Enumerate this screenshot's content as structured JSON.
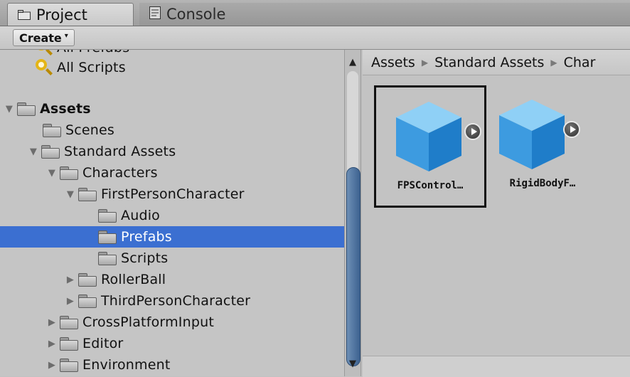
{
  "tabs": {
    "project": {
      "label": "Project",
      "icon": "folder-icon"
    },
    "console": {
      "label": "Console",
      "icon": "console-icon"
    }
  },
  "toolbar": {
    "create_label": "Create"
  },
  "tree": {
    "partial_top_label": "All Prefabs",
    "items": [
      {
        "label": "All Scripts",
        "icon": "search-icon"
      },
      {
        "label": "Assets",
        "icon": "folder-icon",
        "expanded": true
      },
      {
        "label": "Scenes",
        "icon": "folder-icon"
      },
      {
        "label": "Standard Assets",
        "icon": "folder-icon",
        "expanded": true
      },
      {
        "label": "Characters",
        "icon": "folder-icon",
        "expanded": true
      },
      {
        "label": "FirstPersonCharacter",
        "icon": "folder-icon",
        "expanded": true
      },
      {
        "label": "Audio",
        "icon": "folder-icon"
      },
      {
        "label": "Prefabs",
        "icon": "folder-icon",
        "selected": true
      },
      {
        "label": "Scripts",
        "icon": "folder-icon"
      },
      {
        "label": "RollerBall",
        "icon": "folder-icon",
        "expanded": false
      },
      {
        "label": "ThirdPersonCharacter",
        "icon": "folder-icon",
        "expanded": false
      },
      {
        "label": "CrossPlatformInput",
        "icon": "folder-icon",
        "expanded": false
      },
      {
        "label": "Editor",
        "icon": "folder-icon",
        "expanded": false
      },
      {
        "label": "Environment",
        "icon": "folder-icon",
        "expanded": false
      }
    ]
  },
  "breadcrumb": [
    "Assets",
    "Standard Assets",
    "Char"
  ],
  "assets": [
    {
      "label": "FPSControl…",
      "icon": "prefab-cube-icon",
      "selected": true
    },
    {
      "label": "RigidBodyF…",
      "icon": "prefab-cube-icon",
      "selected": false
    }
  ],
  "colors": {
    "selection": "#3b6fd1",
    "panel": "#c5c5c5",
    "cube": "#3ea0e0"
  }
}
